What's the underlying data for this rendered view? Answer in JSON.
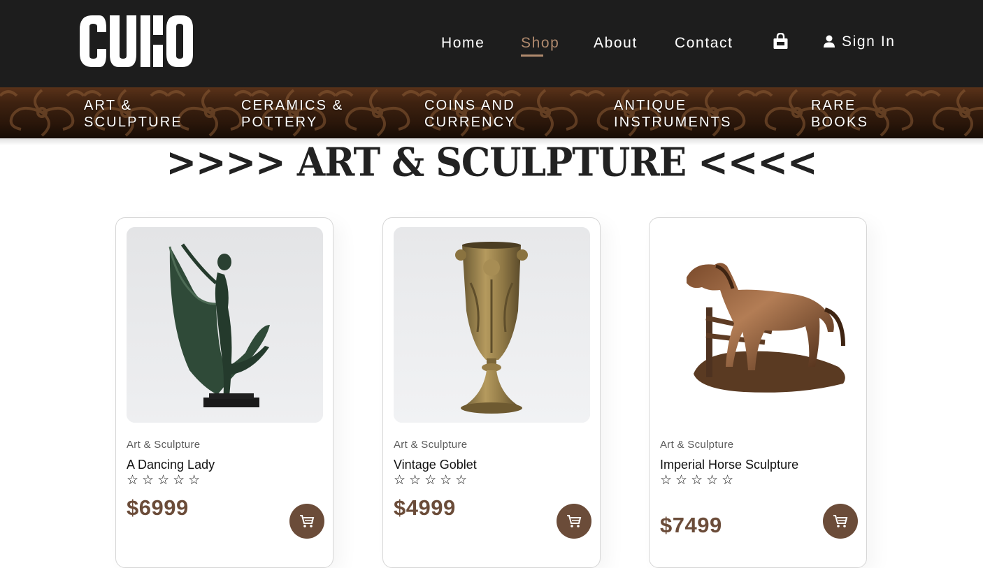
{
  "brand": {
    "logo_text": "CUKO"
  },
  "nav": {
    "items": [
      {
        "label": "Home"
      },
      {
        "label": "Shop",
        "active": true
      },
      {
        "label": "About"
      },
      {
        "label": "Contact"
      }
    ],
    "signin_label": "Sign In",
    "active_color": "#b08a6e"
  },
  "categories": [
    {
      "label": "Art & Sculpture"
    },
    {
      "label": "Ceramics & Pottery"
    },
    {
      "label": "Coins and Currency"
    },
    {
      "label": "Antique Instruments"
    },
    {
      "label": "Rare Books"
    }
  ],
  "page": {
    "heading": ">>>> ART & SCULPTURE <<<<"
  },
  "products": [
    {
      "category": "Art & Sculpture",
      "name": "A Dancing Lady",
      "stars": "☆☆☆☆☆",
      "price": "$6999"
    },
    {
      "category": "Art & Sculpture",
      "name": "Vintage Goblet",
      "stars": "☆☆☆☆☆",
      "price": "$4999"
    },
    {
      "category": "Art & Sculpture",
      "name": "Imperial Horse Sculpture",
      "stars": "☆☆☆☆☆",
      "price": "$7499"
    }
  ],
  "colors": {
    "header_bg": "#1d1d1d",
    "accent": "#6b4c39",
    "active_link": "#b08a6e"
  },
  "icons": {
    "bag": "shopping-bag-icon",
    "user": "user-icon",
    "cart": "cart-icon"
  }
}
